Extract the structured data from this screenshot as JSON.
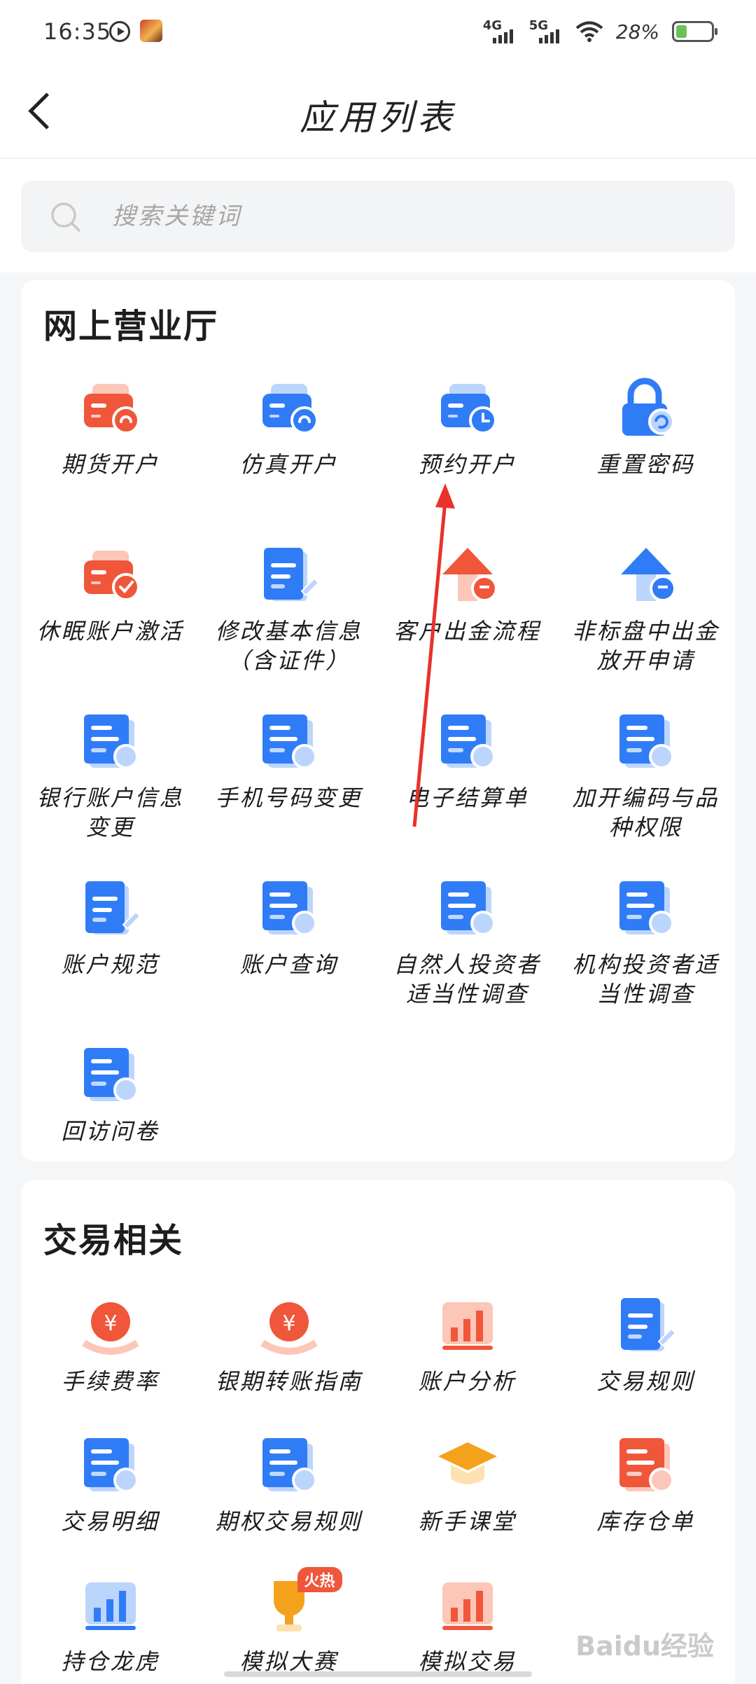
{
  "status_bar": {
    "time": "16:35",
    "signal_1": "4G",
    "signal_2": "5G",
    "battery": "28%"
  },
  "header": {
    "title": "应用列表"
  },
  "search": {
    "placeholder": "搜索关键词"
  },
  "sections": [
    {
      "title": "网上营业厅",
      "items": [
        {
          "label": "期货开户",
          "icon": "card-user-icon",
          "color": "#f0563a"
        },
        {
          "label": "仿真开户",
          "icon": "card-simulate-icon",
          "color": "#2f7cf6"
        },
        {
          "label": "预约开户",
          "icon": "card-clock-icon",
          "color": "#2f7cf6"
        },
        {
          "label": "重置密码",
          "icon": "lock-reset-icon",
          "color": "#2f7cf6"
        },
        {
          "label": "休眠账户激活",
          "icon": "card-check-icon",
          "color": "#f0563a"
        },
        {
          "label": "修改基本信息（含证件）",
          "icon": "document-edit-icon",
          "color": "#2f7cf6"
        },
        {
          "label": "客户出金流程",
          "icon": "upload-single-icon",
          "color": "#f0563a"
        },
        {
          "label": "非标盘中出金放开申请",
          "icon": "upload-multi-icon",
          "color": "#2f7cf6"
        },
        {
          "label": "银行账户信息变更",
          "icon": "bank-card-icon",
          "color": "#2f7cf6"
        },
        {
          "label": "手机号码变更",
          "icon": "phone-refresh-icon",
          "color": "#2f7cf6"
        },
        {
          "label": "电子结算单",
          "icon": "calculator-icon",
          "color": "#2f7cf6"
        },
        {
          "label": "加开编码与品种权限",
          "icon": "list-book-icon",
          "color": "#2f7cf6"
        },
        {
          "label": "账户规范",
          "icon": "profile-doc-icon",
          "color": "#2f7cf6"
        },
        {
          "label": "账户查询",
          "icon": "account-search-icon",
          "color": "#2f7cf6"
        },
        {
          "label": "自然人投资者适当性调查",
          "icon": "person-survey-icon",
          "color": "#2f7cf6"
        },
        {
          "label": "机构投资者适当性调查",
          "icon": "building-survey-icon",
          "color": "#2f7cf6"
        },
        {
          "label": "回访问卷",
          "icon": "visit-survey-icon",
          "color": "#2f7cf6"
        }
      ]
    },
    {
      "title": "交易相关",
      "items": [
        {
          "label": "手续费率",
          "icon": "fee-coin-icon",
          "color": "#f0563a"
        },
        {
          "label": "银期转账指南",
          "icon": "transfer-coin-icon",
          "color": "#f0563a"
        },
        {
          "label": "账户分析",
          "icon": "bar-chart-icon",
          "color": "#f0563a"
        },
        {
          "label": "交易规则",
          "icon": "rules-doc-icon",
          "color": "#2f7cf6"
        },
        {
          "label": "交易明细",
          "icon": "detail-clipboard-icon",
          "color": "#2f7cf6"
        },
        {
          "label": "期权交易规则",
          "icon": "options-clipboard-icon",
          "color": "#2f7cf6"
        },
        {
          "label": "新手课堂",
          "icon": "graduation-cap-icon",
          "color": "#f4a21c"
        },
        {
          "label": "库存仓单",
          "icon": "warehouse-list-icon",
          "color": "#f0563a"
        },
        {
          "label": "持仓龙虎",
          "icon": "trend-screen-icon",
          "color": "#2f7cf6"
        },
        {
          "label": "模拟大赛",
          "icon": "trophy-icon",
          "color": "#f4a21c",
          "badge": "火热"
        },
        {
          "label": "模拟交易",
          "icon": "simulate-chart-icon",
          "color": "#f0563a"
        }
      ]
    }
  ],
  "watermark": "Baidu经验"
}
